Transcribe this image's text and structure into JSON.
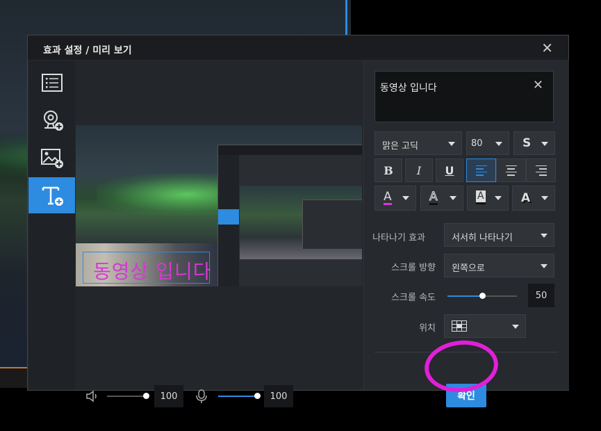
{
  "dialog": {
    "title": "효과 설정 / 미리 보기",
    "close_glyph": "✕"
  },
  "sidebar": {
    "items": [
      {
        "name": "list-icon",
        "active": false
      },
      {
        "name": "add-webcam-icon",
        "active": false
      },
      {
        "name": "add-image-icon",
        "active": false
      },
      {
        "name": "add-text-icon",
        "active": true
      }
    ]
  },
  "preview": {
    "overlay_text": "동영상 입니다"
  },
  "audio": {
    "speaker_volume": "100",
    "mic_volume": "100",
    "speaker_level": 1.0,
    "mic_level": 1.0
  },
  "panel": {
    "text_value": "동영상 입니다",
    "clear_glyph": "✕",
    "font_family": "맑은 고딕",
    "font_size": "80",
    "style_s": "S",
    "bold": "B",
    "italic": "I",
    "underline": "U",
    "align_active": "left",
    "color_a1": "A",
    "color_a2": "A",
    "color_a3": "A",
    "color_a4": "A",
    "appear_effect_label": "나타나기 효과",
    "appear_effect_value": "서서히 나타나기",
    "scroll_dir_label": "스크롤 방향",
    "scroll_dir_value": "왼쪽으로",
    "scroll_speed_label": "스크롤 속도",
    "scroll_speed_value": "50",
    "scroll_speed_level": 0.5,
    "position_label": "위치",
    "confirm_label": "확인"
  },
  "colors": {
    "accent": "#2d8be0",
    "text_color": "#d23ad2",
    "annotation": "#e020d8"
  }
}
